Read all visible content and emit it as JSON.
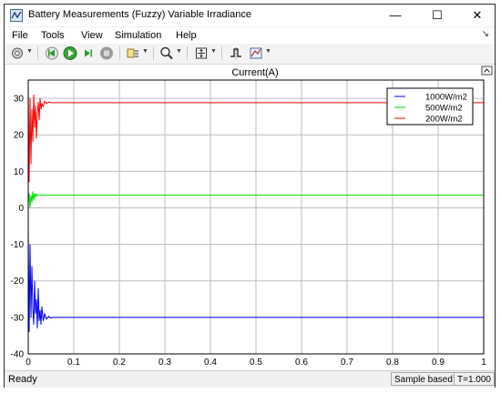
{
  "window": {
    "title": "Battery Measurements (Fuzzy) Variable Irradiance",
    "controls": {
      "minimize": "—",
      "maximize": "☐",
      "close": "✕"
    }
  },
  "menu": {
    "items": [
      "File",
      "Tools",
      "View",
      "Simulation",
      "Help"
    ],
    "overflow_icon": "pin-arrow-icon"
  },
  "toolbar": {
    "icons": [
      "settings-gear-icon",
      "step-back-icon",
      "run-icon",
      "step-forward-icon",
      "stop-icon",
      "highlight-icon",
      "zoom-icon",
      "fit-to-view-icon",
      "triggers-icon",
      "cursor-measurement-icon"
    ]
  },
  "plot": {
    "title": "Current(A)",
    "undock_icon": "undock-icon"
  },
  "status": {
    "left": "Ready",
    "sample": "Sample based",
    "time": "T=1.000"
  },
  "colors": {
    "series_1000": "#0000ff",
    "series_500": "#00dd00",
    "series_200": "#ff0000",
    "grid": "#bdbdbd"
  },
  "chart_data": {
    "type": "line",
    "title": "Current(A)",
    "xlabel": "",
    "ylabel": "",
    "xlim": [
      0,
      1
    ],
    "ylim": [
      -40,
      35
    ],
    "xticks": [
      0,
      0.1,
      0.2,
      0.3,
      0.4,
      0.5,
      0.6,
      0.7,
      0.8,
      0.9,
      1
    ],
    "yticks": [
      -40,
      -30,
      -20,
      -10,
      0,
      10,
      20,
      30
    ],
    "grid": true,
    "legend_position": "top-right",
    "series": [
      {
        "name": "1000W/m2",
        "color": "#0000ff",
        "x": [
          0,
          0.002,
          0.004,
          0.006,
          0.008,
          0.01,
          0.012,
          0.014,
          0.016,
          0.018,
          0.02,
          0.022,
          0.024,
          0.026,
          0.028,
          0.03,
          0.033,
          0.036,
          0.04,
          0.045,
          0.05,
          0.055,
          1
        ],
        "y": [
          -6,
          -34,
          -10,
          -30,
          -16,
          -27,
          -32,
          -20,
          -29,
          -25,
          -33,
          -22,
          -31,
          -28,
          -32,
          -27,
          -31,
          -29,
          -30.5,
          -29.7,
          -30.2,
          -30,
          -30
        ]
      },
      {
        "name": "500W/m2",
        "color": "#00dd00",
        "x": [
          0,
          0.002,
          0.004,
          0.006,
          0.008,
          0.01,
          0.012,
          0.014,
          0.016,
          0.018,
          0.02,
          0.025,
          0.03,
          0.04,
          1
        ],
        "y": [
          1,
          4,
          0,
          3.5,
          1.5,
          4.5,
          2,
          4,
          3,
          3.8,
          3.3,
          3.6,
          3.5,
          3.5,
          3.5
        ]
      },
      {
        "name": "200W/m2",
        "color": "#ff0000",
        "x": [
          0,
          0.002,
          0.004,
          0.006,
          0.008,
          0.01,
          0.012,
          0.014,
          0.016,
          0.018,
          0.02,
          0.022,
          0.024,
          0.026,
          0.028,
          0.03,
          0.033,
          0.036,
          0.04,
          0.045,
          0.05,
          1
        ],
        "y": [
          33,
          7,
          30,
          12,
          27,
          18,
          31,
          22,
          28,
          19,
          26,
          29,
          24,
          30,
          27,
          28.5,
          27.8,
          29.2,
          28.6,
          29,
          28.8,
          28.8
        ]
      }
    ]
  }
}
